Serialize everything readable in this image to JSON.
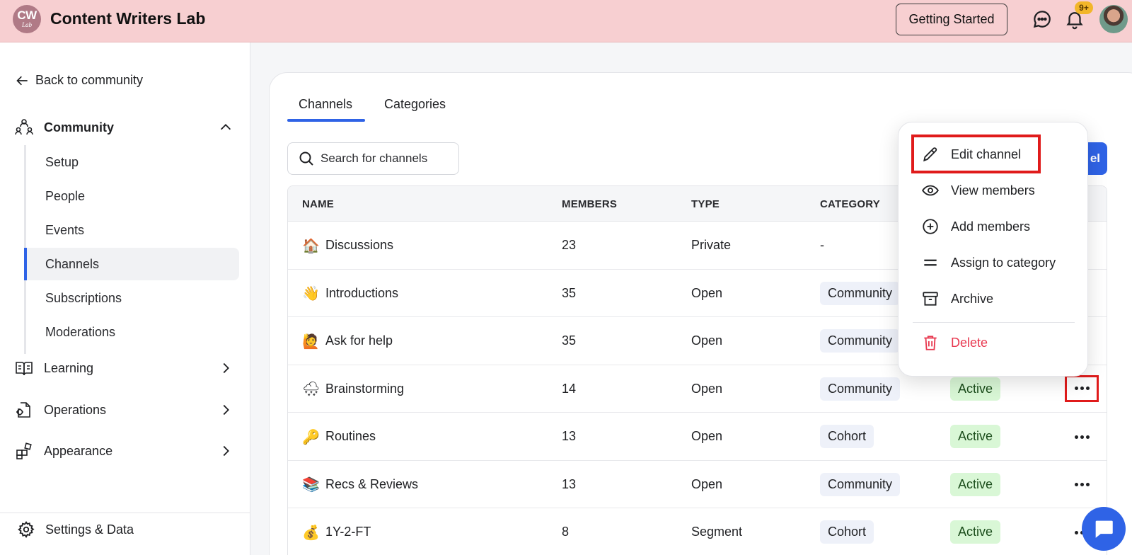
{
  "header": {
    "logo_top": "CW",
    "logo_bottom": "Lab",
    "app_title": "Content Writers Lab",
    "getting_started": "Getting Started",
    "notification_badge": "9+"
  },
  "sidebar": {
    "back_link": "Back to community",
    "community": {
      "label": "Community",
      "items": [
        {
          "label": "Setup",
          "active": false
        },
        {
          "label": "People",
          "active": false
        },
        {
          "label": "Events",
          "active": false
        },
        {
          "label": "Channels",
          "active": true
        },
        {
          "label": "Subscriptions",
          "active": false
        },
        {
          "label": "Moderations",
          "active": false
        }
      ]
    },
    "learning": "Learning",
    "operations": "Operations",
    "appearance": "Appearance",
    "settings": "Settings & Data"
  },
  "tabs": [
    {
      "label": "Channels",
      "active": true
    },
    {
      "label": "Categories",
      "active": false
    }
  ],
  "search": {
    "placeholder": "Search for channels"
  },
  "create_button_partial": "el",
  "table": {
    "columns": [
      "NAME",
      "MEMBERS",
      "TYPE",
      "CATEGORY"
    ],
    "rows": [
      {
        "emoji": "🏠",
        "name": "Discussions",
        "members": "23",
        "type": "Private",
        "category": "-",
        "status": ""
      },
      {
        "emoji": "👋",
        "name": "Introductions",
        "members": "35",
        "type": "Open",
        "category": "Community",
        "status": ""
      },
      {
        "emoji": "🙋",
        "name": "Ask for help",
        "members": "35",
        "type": "Open",
        "category": "Community",
        "status": ""
      },
      {
        "emoji": "🌨",
        "name": "Brainstorming",
        "members": "14",
        "type": "Open",
        "category": "Community",
        "status": "Active"
      },
      {
        "emoji": "🔑",
        "name": "Routines",
        "members": "13",
        "type": "Open",
        "category": "Cohort",
        "status": "Active"
      },
      {
        "emoji": "📚",
        "name": "Recs & Reviews",
        "members": "13",
        "type": "Open",
        "category": "Community",
        "status": "Active"
      },
      {
        "emoji": "💰",
        "name": "1Y-2-FT",
        "members": "8",
        "type": "Segment",
        "category": "Cohort",
        "status": "Active"
      }
    ]
  },
  "menu": {
    "items": [
      {
        "label": "Edit channel",
        "icon": "pencil-icon"
      },
      {
        "label": "View members",
        "icon": "eye-icon"
      },
      {
        "label": "Add members",
        "icon": "plus-circle-icon"
      },
      {
        "label": "Assign to category",
        "icon": "equals-icon"
      },
      {
        "label": "Archive",
        "icon": "archive-icon"
      },
      {
        "label": "Delete",
        "icon": "trash-icon"
      }
    ]
  },
  "colors": {
    "topbar": "#f7cfd1",
    "accent": "#2f63e6",
    "highlight": "#e01b1b",
    "active_pill": "#d9f7d6",
    "delete": "#e8384f"
  }
}
